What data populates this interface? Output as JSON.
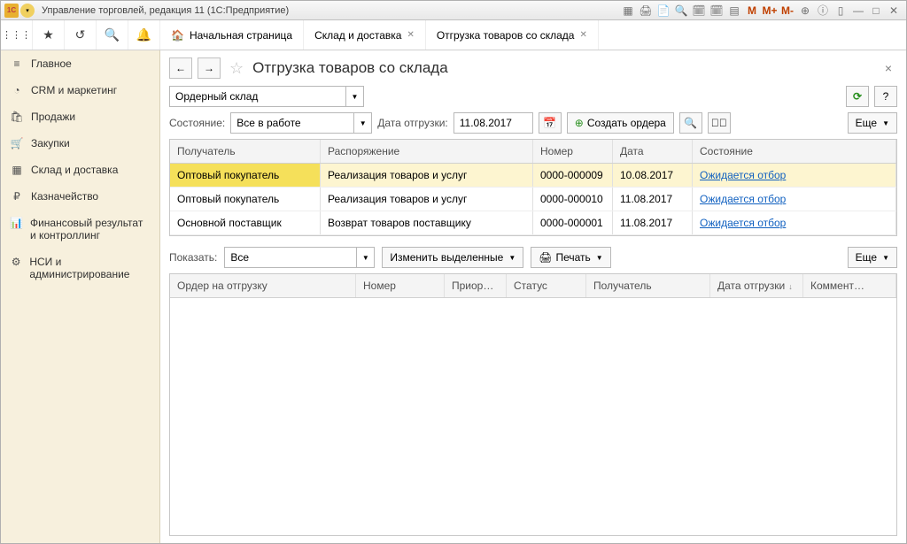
{
  "titlebar": {
    "app_badge": "1C",
    "title": "Управление торговлей, редакция 11 (1С:Предприятие)",
    "m_buttons": [
      "M",
      "M+",
      "M-"
    ]
  },
  "tabs": {
    "home": "Начальная страница",
    "tab1": "Склад и доставка",
    "tab2": "Отгрузка товаров со склада"
  },
  "sidebar": [
    {
      "icon": "≡",
      "label": "Главное"
    },
    {
      "icon": "◔",
      "label": "CRM и маркетинг"
    },
    {
      "icon": "🛍",
      "label": "Продажи"
    },
    {
      "icon": "🛒",
      "label": "Закупки"
    },
    {
      "icon": "▦",
      "label": "Склад и доставка"
    },
    {
      "icon": "₽",
      "label": "Казначейство"
    },
    {
      "icon": "📊",
      "label": "Финансовый результат и контроллинг"
    },
    {
      "icon": "⚙",
      "label": "НСИ и администрирование"
    }
  ],
  "page": {
    "title": "Отгрузка товаров со склада",
    "warehouse": "Ордерный склад",
    "state_label": "Состояние:",
    "state_value": "Все в работе",
    "date_label": "Дата отгрузки:",
    "date_value": "11.08.2017",
    "create_orders": "Создать ордера",
    "more": "Еще"
  },
  "table1": {
    "headers": {
      "recipient": "Получатель",
      "disposition": "Распоряжение",
      "number": "Номер",
      "date": "Дата",
      "state": "Состояние"
    },
    "rows": [
      {
        "recipient": "Оптовый покупатель",
        "disposition": "Реализация товаров и услуг",
        "number": "0000-000009",
        "date": "10.08.2017",
        "state": "Ожидается отбор",
        "selected": true
      },
      {
        "recipient": "Оптовый покупатель",
        "disposition": "Реализация товаров и услуг",
        "number": "0000-000010",
        "date": "11.08.2017",
        "state": "Ожидается отбор"
      },
      {
        "recipient": "Основной поставщик",
        "disposition": "Возврат товаров поставщику",
        "number": "0000-000001",
        "date": "11.08.2017",
        "state": "Ожидается отбор"
      }
    ]
  },
  "lower": {
    "show_label": "Показать:",
    "show_value": "Все",
    "edit_selected": "Изменить выделенные",
    "print": "Печать",
    "more": "Еще",
    "headers": {
      "order": "Ордер на отгрузку",
      "number": "Номер",
      "priority": "Приоритет",
      "status": "Статус",
      "recipient": "Получатель",
      "date": "Дата отгрузки",
      "comment": "Коммент…"
    }
  }
}
